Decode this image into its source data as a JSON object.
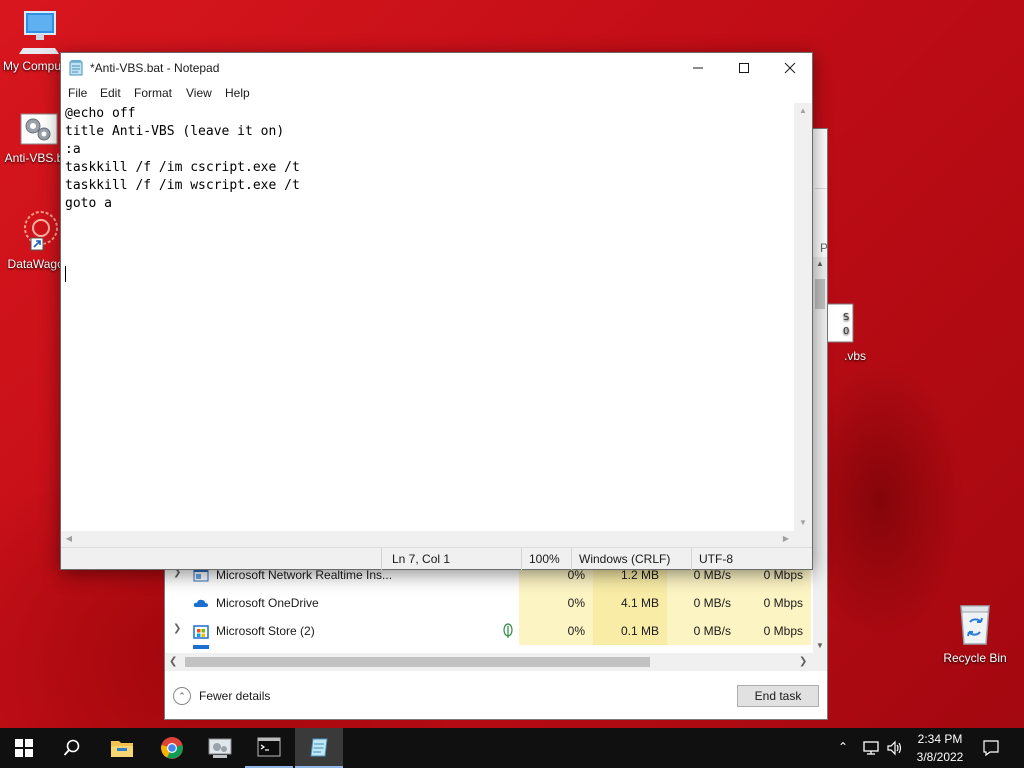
{
  "desktop": {
    "icons": [
      {
        "label": "My Computer",
        "icon": "computer-icon"
      },
      {
        "label": "Anti-VBS.bat",
        "icon": "batch-file-icon"
      },
      {
        "label": "DataWagon",
        "icon": "shortcut-icon"
      },
      {
        "label": ".vbs",
        "icon": "script-file-icon"
      },
      {
        "label": "Recycle Bin",
        "icon": "recycle-bin-icon"
      }
    ]
  },
  "taskmanager": {
    "rows": [
      {
        "name": "Microsoft Network Realtime Ins...",
        "cpu": "0%",
        "memory": "1.2 MB",
        "disk": "0 MB/s",
        "network": "0 Mbps",
        "expandable": true
      },
      {
        "name": "Microsoft OneDrive",
        "cpu": "0%",
        "memory": "4.1 MB",
        "disk": "0 MB/s",
        "network": "0 Mbps",
        "expandable": false
      },
      {
        "name": "Microsoft Store (2)",
        "cpu": "0%",
        "memory": "0.1 MB",
        "disk": "0 MB/s",
        "network": "0 Mbps",
        "expandable": true,
        "suspended_icon": "leaf-icon"
      }
    ],
    "fewer_details": "Fewer details",
    "end_task": "End task",
    "partial_header_letter": "P"
  },
  "notepad": {
    "title": "*Anti-VBS.bat - Notepad",
    "menu": [
      "File",
      "Edit",
      "Format",
      "View",
      "Help"
    ],
    "content": "@echo off\ntitle Anti-VBS (leave it on)\n:a\ntaskkill /f /im cscript.exe /t\ntaskkill /f /im wscript.exe /t\ngoto a\n",
    "status": {
      "position": "Ln 7, Col 1",
      "zoom": "100%",
      "line_ending": "Windows (CRLF)",
      "encoding": "UTF-8"
    }
  },
  "taskbar": {
    "apps": [
      "start-icon",
      "search-icon",
      "file-explorer-icon",
      "chrome-icon",
      "control-panel-icon",
      "cmd-icon",
      "notepad-icon"
    ],
    "time": "2:34 PM",
    "date": "3/8/2022"
  }
}
